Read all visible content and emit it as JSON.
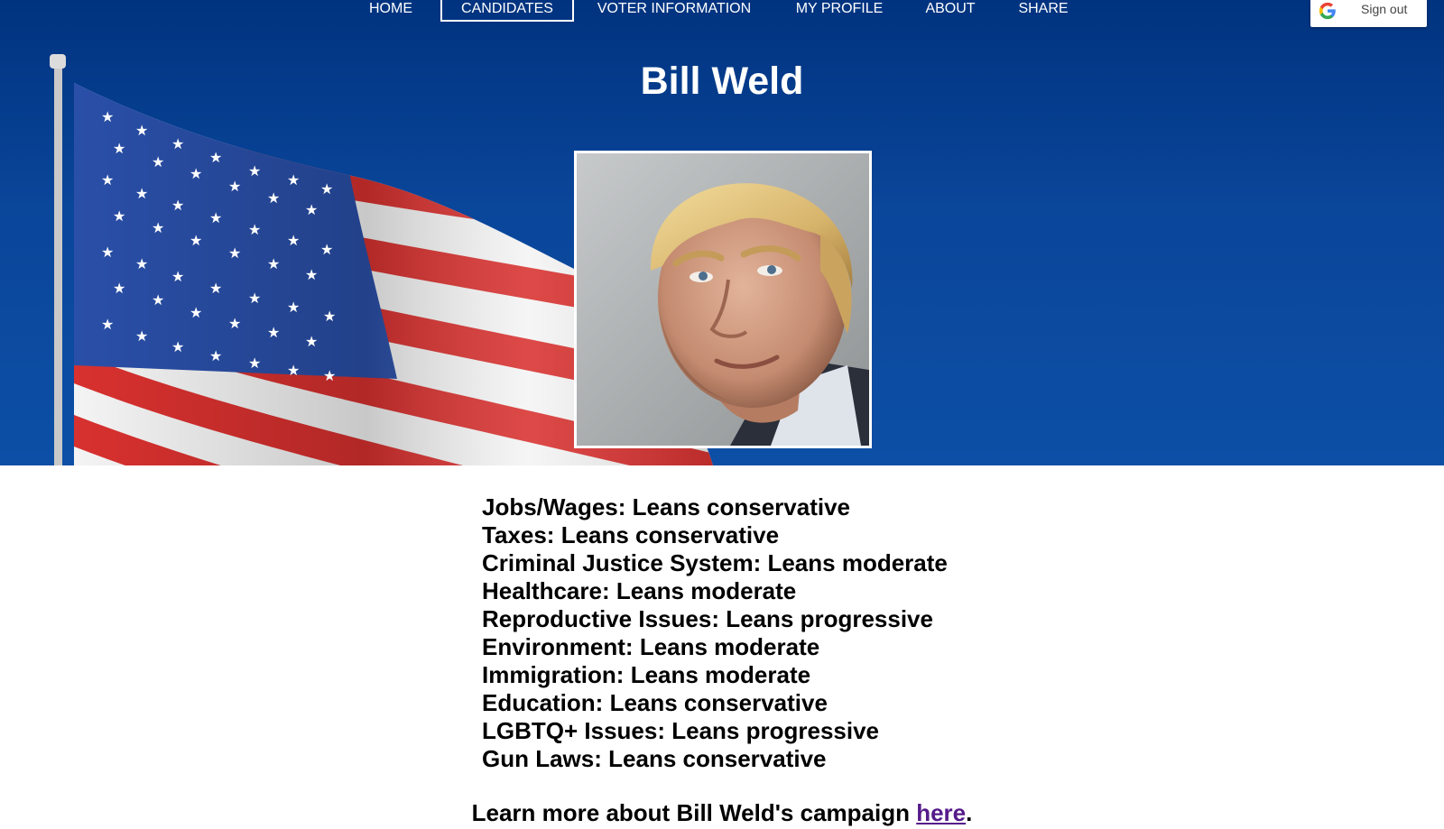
{
  "nav": {
    "items": [
      {
        "label": "HOME"
      },
      {
        "label": "CANDIDATES",
        "active": true
      },
      {
        "label": "VOTER INFORMATION"
      },
      {
        "label": "MY PROFILE"
      },
      {
        "label": "ABOUT"
      },
      {
        "label": "SHARE"
      }
    ]
  },
  "account": {
    "sign_out_label": "Sign out"
  },
  "candidate": {
    "name": "Bill Weld",
    "photo_icon": "candidate-portrait"
  },
  "stances": [
    {
      "topic": "Jobs/Wages",
      "position": "Leans conservative"
    },
    {
      "topic": "Taxes",
      "position": "Leans conservative"
    },
    {
      "topic": "Criminal Justice System",
      "position": "Leans moderate"
    },
    {
      "topic": "Healthcare",
      "position": "Leans moderate"
    },
    {
      "topic": "Reproductive Issues",
      "position": "Leans progressive"
    },
    {
      "topic": "Environment",
      "position": "Leans moderate"
    },
    {
      "topic": "Immigration",
      "position": "Leans moderate"
    },
    {
      "topic": "Education",
      "position": "Leans conservative"
    },
    {
      "topic": "LGBTQ+ Issues",
      "position": "Leans progressive"
    },
    {
      "topic": "Gun Laws",
      "position": "Leans conservative"
    }
  ],
  "learn_more": {
    "prefix": "Learn more about Bill Weld's campaign ",
    "link_text": "here",
    "suffix": "."
  },
  "colors": {
    "hero_blue": "#0a469a",
    "link_visited": "#551a8b",
    "flag_red": "#d8312f",
    "flag_blue": "#2a4fa8"
  }
}
